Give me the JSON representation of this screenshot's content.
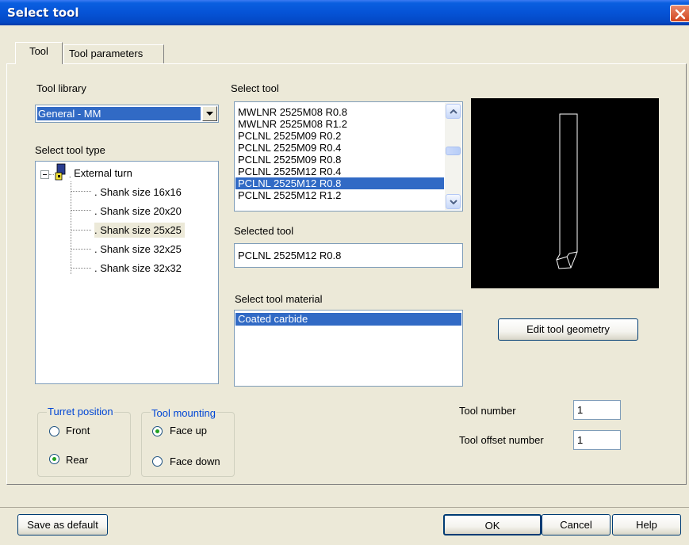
{
  "window": {
    "title": "Select tool"
  },
  "tabs": [
    {
      "label": "Tool",
      "active": true
    },
    {
      "label": "Tool parameters",
      "active": false
    }
  ],
  "tool_library": {
    "label": "Tool library",
    "value": "General - MM"
  },
  "tool_type": {
    "label": "Select tool type",
    "root": "External turn",
    "children": [
      "Shank size 16x16",
      "Shank size 20x20",
      "Shank size 25x25",
      "Shank size 32x25",
      "Shank size 32x32"
    ],
    "selected_index": 2
  },
  "select_tool": {
    "label": "Select tool",
    "items": [
      "MWLNR 2525M08 R0.8",
      "MWLNR 2525M08 R1.2",
      "PCLNL 2525M09 R0.2",
      "PCLNL 2525M09 R0.4",
      "PCLNL 2525M09 R0.8",
      "PCLNL 2525M12 R0.4",
      "PCLNL 2525M12 R0.8",
      "PCLNL 2525M12 R1.2"
    ],
    "selected_index": 6
  },
  "selected_tool": {
    "label": "Selected tool",
    "value": "PCLNL 2525M12 R0.8"
  },
  "tool_material": {
    "label": "Select tool material",
    "items": [
      "Coated carbide"
    ],
    "selected_index": 0
  },
  "edit_geometry_label": "Edit tool geometry",
  "turret": {
    "title": "Turret position",
    "options": [
      "Front",
      "Rear"
    ],
    "selected": "Rear"
  },
  "mounting": {
    "title": "Tool mounting",
    "options": [
      "Face up",
      "Face down"
    ],
    "selected": "Face up"
  },
  "tool_number": {
    "label": "Tool number",
    "value": "1"
  },
  "tool_offset": {
    "label": "Tool offset number",
    "value": "1"
  },
  "footer": {
    "save_default": "Save as default",
    "ok": "OK",
    "cancel": "Cancel",
    "help": "Help"
  },
  "colors": {
    "selection": "#316ac5",
    "titlebar": "#0553d6",
    "group_title": "#0046d5"
  }
}
